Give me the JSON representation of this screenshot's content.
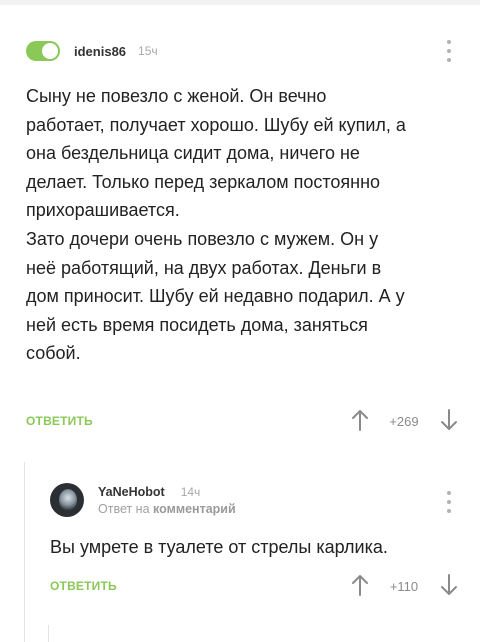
{
  "comments": [
    {
      "username": "idenis86",
      "time": "15ч",
      "text": "Сыну не повезло с женой. Он вечно\nработает, получает хорошо. Шубу ей купил, а\nона бездельница сидит дома, ничего не\nделает. Только перед зеркалом постоянно\nприхорашивается.\nЗато дочери очень повезло с мужем. Он у\nнеё работящий, на двух работах. Деньги в\nдом приносит. Шубу ей недавно подарил. А у\nней есть время посидеть дома, заняться\nсобой.",
      "reply_label": "ОТВЕТИТЬ",
      "rating": "+269"
    },
    {
      "username": "YaNeHobot",
      "time": "14ч",
      "reply_to_prefix": "Ответ на",
      "reply_to_target": "комментарий",
      "text": "Вы умрете в туалете от стрелы карлика.",
      "reply_label": "ОТВЕТИТЬ",
      "rating": "+110"
    }
  ],
  "colors": {
    "accent_green": "#8ac858",
    "muted_gray": "#a8a8a8"
  },
  "icons": [
    "toggle-switch-icon",
    "kebab-menu-icon",
    "arrow-up-icon",
    "arrow-down-icon",
    "avatar"
  ]
}
